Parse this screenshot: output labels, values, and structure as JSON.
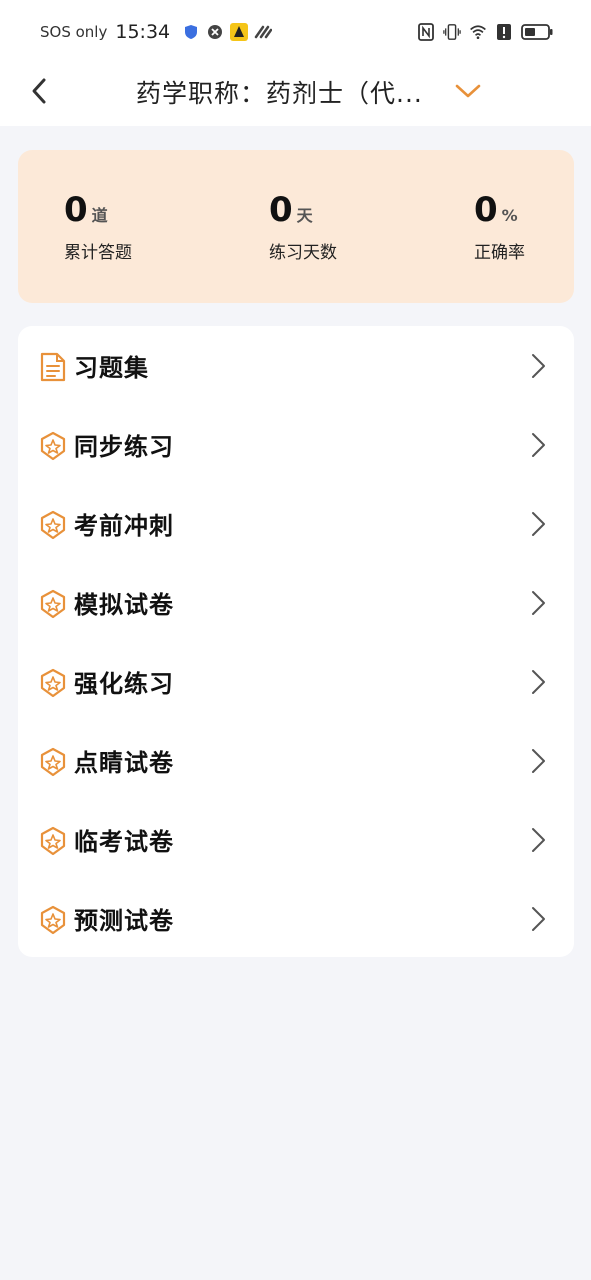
{
  "status_bar": {
    "carrier": "SOS only",
    "time": "15:34",
    "left_icons": [
      "shield-icon",
      "block-icon",
      "app-badge-icon",
      "link-icon"
    ],
    "right_icons": [
      "nfc-icon",
      "vibrate-icon",
      "wifi-icon",
      "alert-icon",
      "battery-icon"
    ]
  },
  "header": {
    "title": "药学职称：药剂士（代...",
    "back_icon": "chevron-left-icon",
    "dropdown_icon": "chevron-down-icon",
    "accent_color": "#e8913a"
  },
  "stats": [
    {
      "value": "0",
      "unit": "道",
      "label": "累计答题"
    },
    {
      "value": "0",
      "unit": "天",
      "label": "练习天数"
    },
    {
      "value": "0",
      "unit": "%",
      "label": "正确率"
    }
  ],
  "menu": [
    {
      "label": "习题集",
      "icon": "document-icon"
    },
    {
      "label": "同步练习",
      "icon": "star-badge-icon"
    },
    {
      "label": "考前冲刺",
      "icon": "star-badge-icon"
    },
    {
      "label": "模拟试卷",
      "icon": "star-badge-icon"
    },
    {
      "label": "强化练习",
      "icon": "star-badge-icon"
    },
    {
      "label": "点睛试卷",
      "icon": "star-badge-icon"
    },
    {
      "label": "临考试卷",
      "icon": "star-badge-icon"
    },
    {
      "label": "预测试卷",
      "icon": "star-badge-icon"
    }
  ],
  "colors": {
    "stats_bg": "#fce9d8",
    "page_bg": "#f4f5f9",
    "icon_orange": "#e8913a"
  }
}
